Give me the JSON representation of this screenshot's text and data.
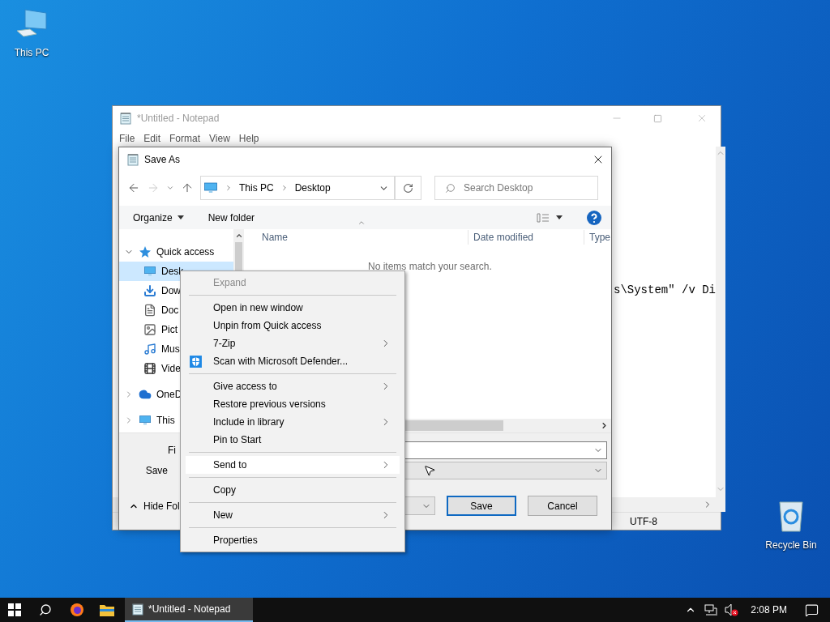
{
  "desktop_icons": [
    {
      "kind": "computer",
      "label": "This PC"
    },
    {
      "kind": "recycle",
      "label": "Recycle Bin"
    }
  ],
  "notepad": {
    "title": "*Untitled - Notepad",
    "menu": [
      "File",
      "Edit",
      "Format",
      "View",
      "Help"
    ],
    "text_line": "s\\System\" /v Di",
    "encoding": "UTF-8"
  },
  "save_dialog": {
    "title": "Save As",
    "breadcrumb": [
      "This PC",
      "Desktop"
    ],
    "search_placeholder": "Search Desktop",
    "organize": "Organize",
    "new_folder": "New folder",
    "nav": [
      {
        "kind": "star",
        "label": "Quick access",
        "expanded": true,
        "selected": false,
        "children": [
          {
            "kind": "desktop",
            "label": "Desk",
            "selected": true
          },
          {
            "kind": "downloads",
            "label": "Dow",
            "selected": false
          },
          {
            "kind": "documents",
            "label": "Doc",
            "selected": false
          },
          {
            "kind": "pictures",
            "label": "Pict",
            "selected": false
          },
          {
            "kind": "music",
            "label": "Mus",
            "selected": false
          },
          {
            "kind": "videos",
            "label": "Vide",
            "selected": false
          }
        ]
      },
      {
        "kind": "cloud",
        "label": "OneD",
        "expanded": false,
        "selected": false
      },
      {
        "kind": "computer",
        "label": "This",
        "expanded": false,
        "selected": false
      }
    ],
    "columns": [
      "Name",
      "Date modified",
      "Type"
    ],
    "empty_message": "No items match your search.",
    "file_name_label": "Fi",
    "save_type_label": "Save",
    "hide_folders": "Hide Fol",
    "buttons": [
      {
        "label": "Save",
        "default": true
      },
      {
        "label": "Cancel",
        "default": false
      }
    ]
  },
  "context_menu": [
    {
      "kind": "item",
      "label": "Expand",
      "disabled": true,
      "submenu": false,
      "selected": false
    },
    {
      "kind": "separator"
    },
    {
      "kind": "item",
      "label": "Open in new window",
      "disabled": false,
      "submenu": false,
      "selected": false
    },
    {
      "kind": "item",
      "label": "Unpin from Quick access",
      "disabled": false,
      "submenu": false,
      "selected": false
    },
    {
      "kind": "item",
      "label": "7-Zip",
      "disabled": false,
      "submenu": true,
      "selected": false
    },
    {
      "kind": "shield-item",
      "label": "Scan with Microsoft Defender...",
      "disabled": false,
      "submenu": false,
      "selected": false
    },
    {
      "kind": "separator"
    },
    {
      "kind": "item",
      "label": "Give access to",
      "disabled": false,
      "submenu": true,
      "selected": false
    },
    {
      "kind": "item",
      "label": "Restore previous versions",
      "disabled": false,
      "submenu": false,
      "selected": false
    },
    {
      "kind": "item",
      "label": "Include in library",
      "disabled": false,
      "submenu": true,
      "selected": false
    },
    {
      "kind": "item",
      "label": "Pin to Start",
      "disabled": false,
      "submenu": false,
      "selected": false
    },
    {
      "kind": "separator"
    },
    {
      "kind": "item",
      "label": "Send to",
      "disabled": false,
      "submenu": true,
      "selected": true
    },
    {
      "kind": "separator"
    },
    {
      "kind": "item",
      "label": "Copy",
      "disabled": false,
      "submenu": false,
      "selected": false
    },
    {
      "kind": "separator"
    },
    {
      "kind": "item",
      "label": "New",
      "disabled": false,
      "submenu": true,
      "selected": false
    },
    {
      "kind": "separator"
    },
    {
      "kind": "item",
      "label": "Properties",
      "disabled": false,
      "submenu": false,
      "selected": false
    }
  ],
  "taskbar": {
    "task": {
      "title": "*Untitled - Notepad",
      "selected": true
    },
    "muted": true,
    "clock": "2:08 PM"
  }
}
